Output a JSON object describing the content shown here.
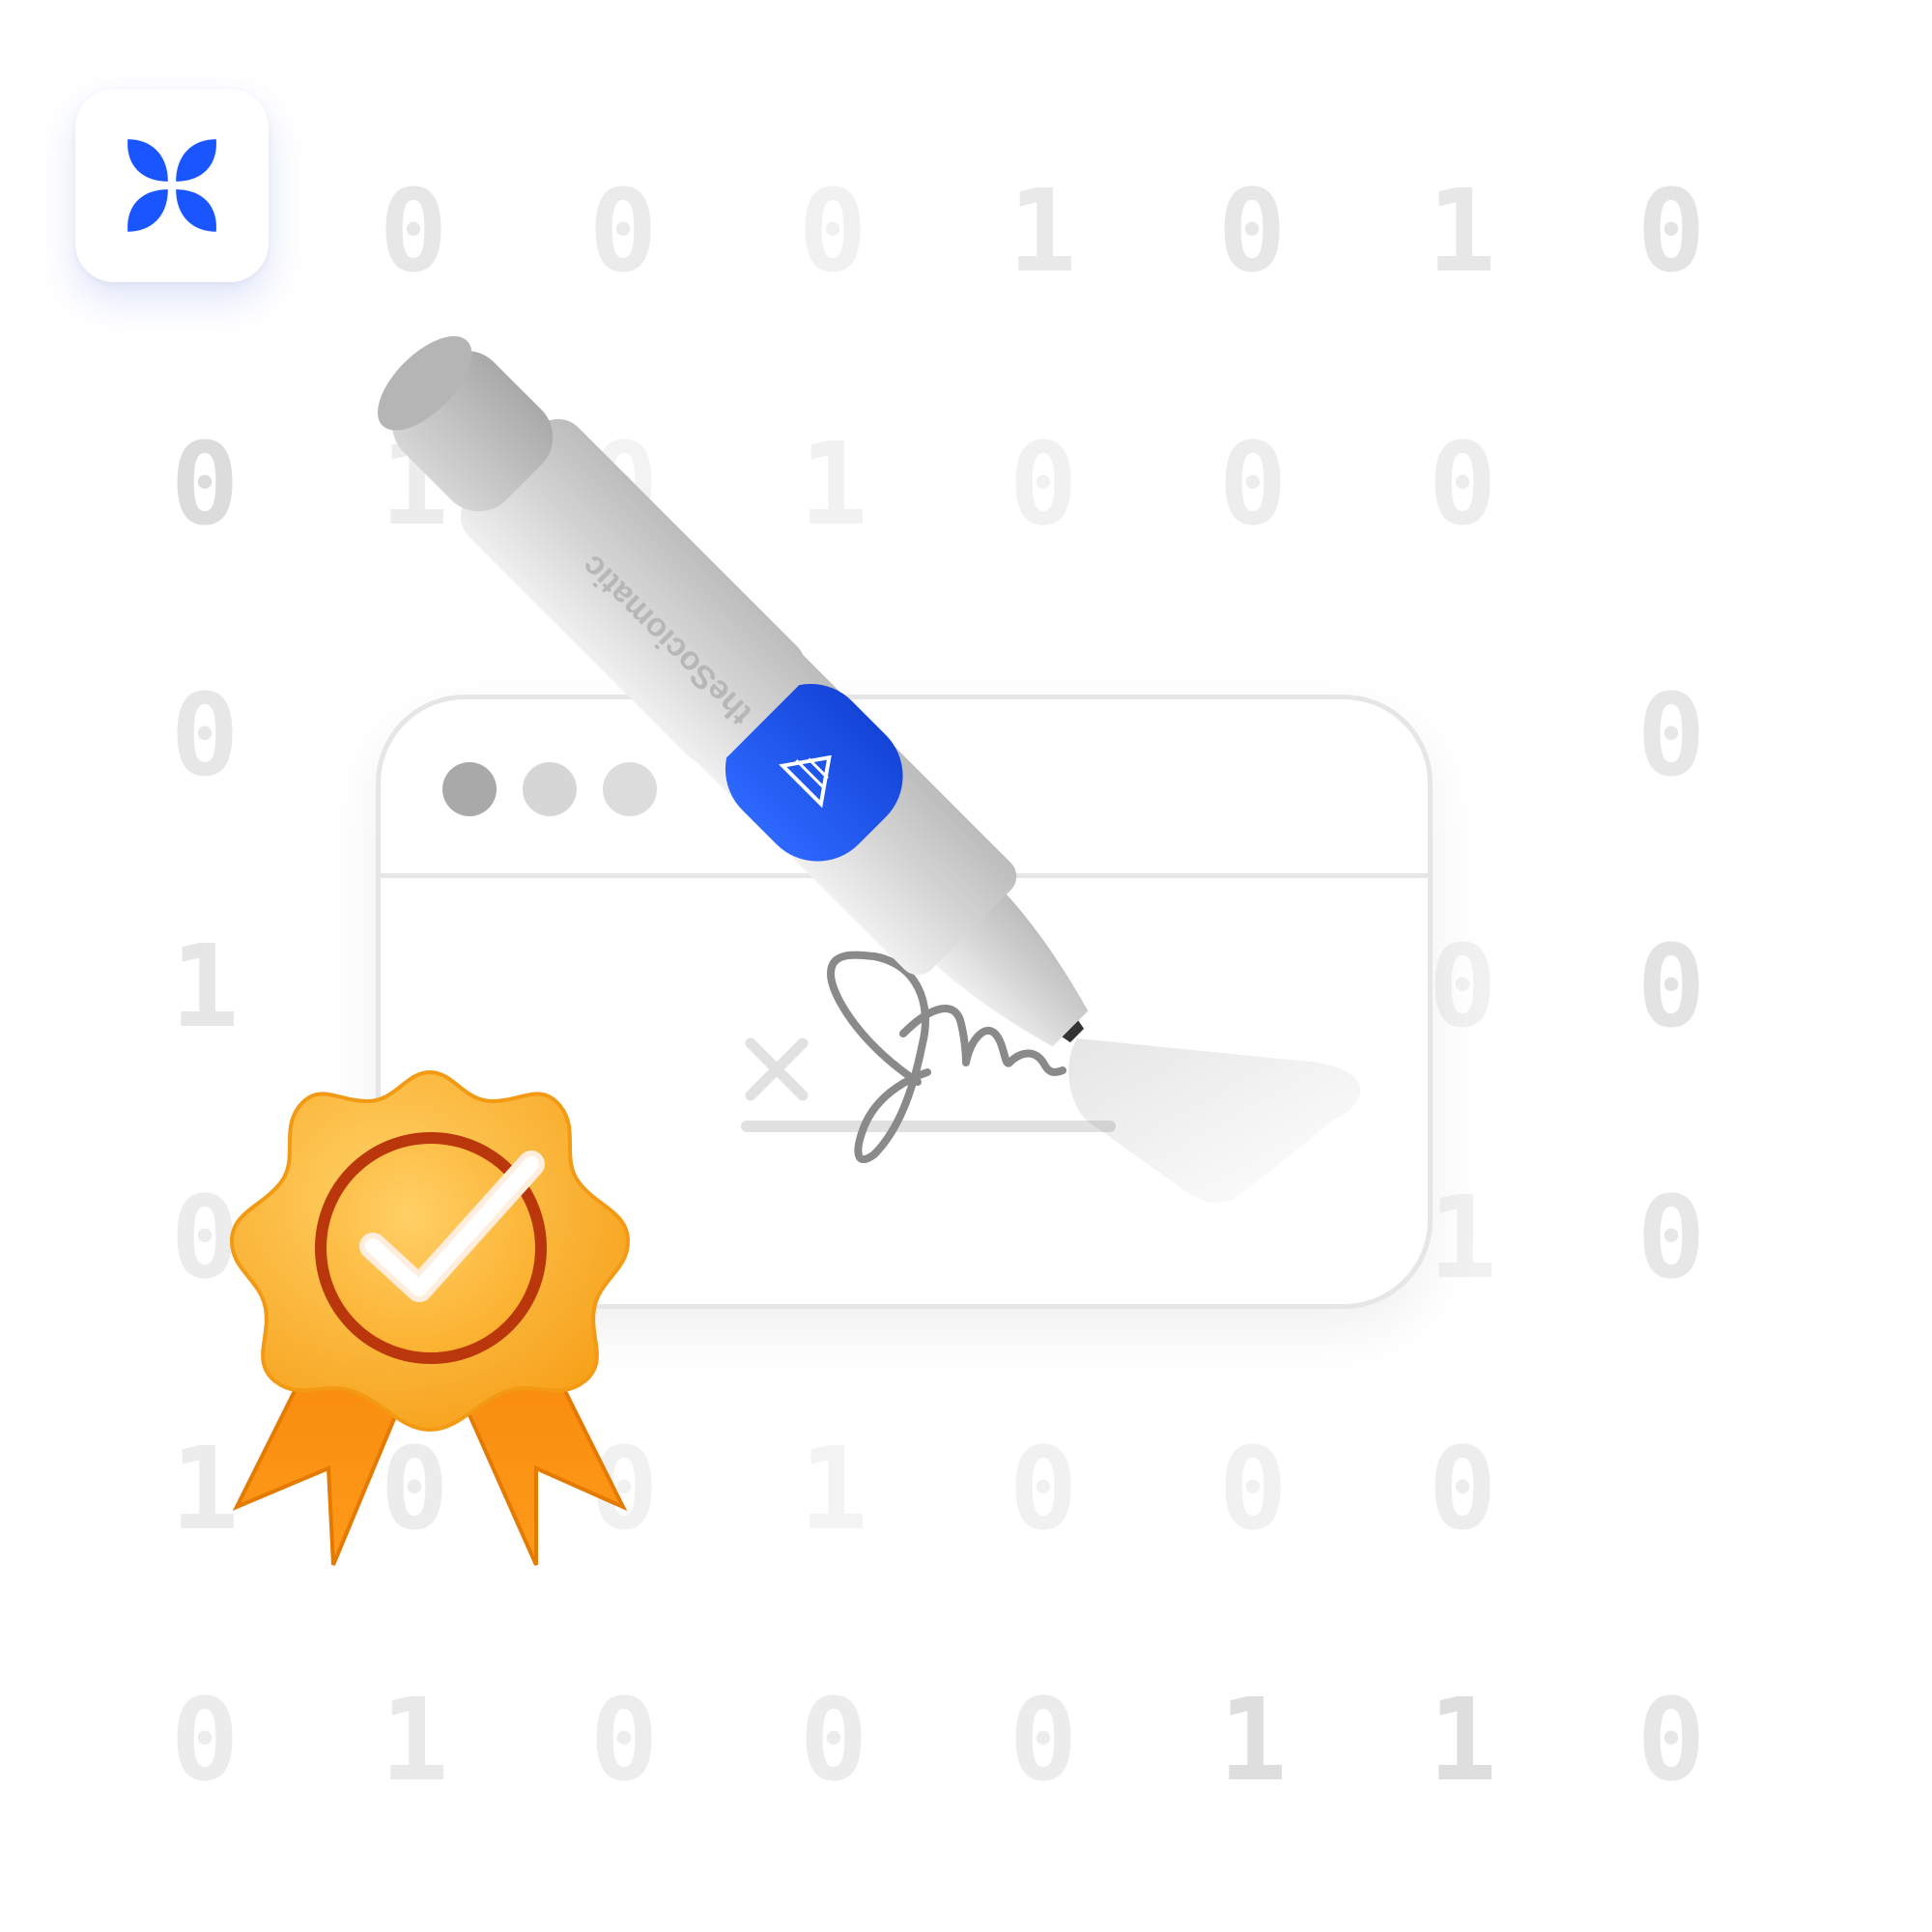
{
  "app": {
    "icon": "butterfly-logo-icon",
    "brand_color": "#1a56ff"
  },
  "background_digits": [
    [
      "0",
      "0",
      "0",
      "1",
      "0",
      "1",
      "0"
    ],
    [
      "0",
      "1",
      "0",
      "1",
      "0",
      "0",
      "0"
    ],
    [
      "0",
      "",
      "",
      "",
      "",
      "",
      "0"
    ],
    [
      "1",
      "",
      "",
      "",
      "",
      "0",
      "0"
    ],
    [
      "0",
      "",
      "",
      "",
      "",
      "1",
      "0"
    ],
    [
      "1",
      "0",
      "0",
      "1",
      "0",
      "0",
      "0"
    ],
    [
      "0",
      "1",
      "0",
      "0",
      "0",
      "1",
      "1",
      "0"
    ]
  ],
  "document_window": {
    "icon": "browser-window-icon",
    "dot_colors": [
      "#a9a9a9",
      "#d6d6d6",
      "#dcdcdc"
    ],
    "sign_mark_icon": "sign-here-x-icon",
    "signature_icon": "handwritten-signature"
  },
  "pen": {
    "icon": "pen-icon",
    "brand_text": "theSociomatic",
    "band_color": "#1a56ff"
  },
  "badge": {
    "icon": "award-ribbon-checkmark-icon",
    "color": "#fba92a"
  }
}
